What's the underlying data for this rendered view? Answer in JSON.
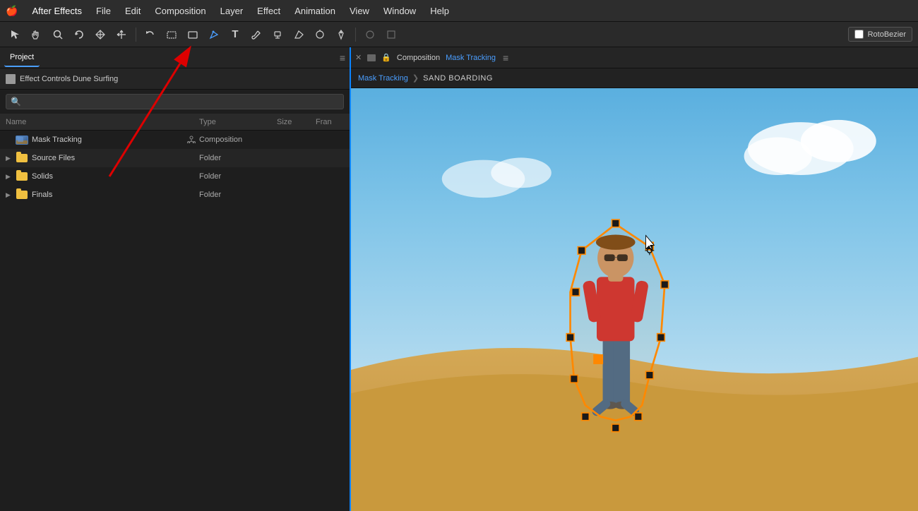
{
  "menubar": {
    "apple": "🍎",
    "items": [
      "After Effects",
      "File",
      "Edit",
      "Composition",
      "Layer",
      "Effect",
      "Animation",
      "View",
      "Window",
      "Help"
    ]
  },
  "toolbar": {
    "tools": [
      {
        "name": "selection-tool",
        "icon": "↖",
        "title": "Selection Tool"
      },
      {
        "name": "hand-tool",
        "icon": "✋",
        "title": "Hand Tool"
      },
      {
        "name": "zoom-tool",
        "icon": "🔍",
        "title": "Zoom Tool"
      },
      {
        "name": "rotate-tool",
        "icon": "↻",
        "title": "Rotate Tool"
      },
      {
        "name": "translate-tool",
        "icon": "✤",
        "title": "Translate Tool"
      },
      {
        "name": "move-tool",
        "icon": "↕",
        "title": "Move Tool"
      },
      {
        "name": "undo-tool",
        "icon": "↶",
        "title": "Undo"
      },
      {
        "name": "rect-tool",
        "icon": "⬜",
        "title": "Rectangle Tool"
      },
      {
        "name": "shape-tool",
        "icon": "⬛",
        "title": "Shape Tool"
      },
      {
        "name": "pen-tool",
        "icon": "✒",
        "title": "Pen Tool"
      },
      {
        "name": "text-tool",
        "icon": "T",
        "title": "Text Tool"
      },
      {
        "name": "brush-tool",
        "icon": "🖌",
        "title": "Brush Tool"
      },
      {
        "name": "stamp-tool",
        "icon": "⊕",
        "title": "Clone Stamp Tool"
      },
      {
        "name": "eraser-tool",
        "icon": "◇",
        "title": "Eraser Tool"
      },
      {
        "name": "roto-tool",
        "icon": "⊗",
        "title": "Roto Brush Tool"
      },
      {
        "name": "pin-tool",
        "icon": "📌",
        "title": "Pin Tool"
      }
    ],
    "roto_bezier_label": "RotoBezier"
  },
  "left_panel": {
    "project_tab": "Project",
    "effect_controls_tab": "Effect Controls Dune Surfing",
    "search_placeholder": "🔍",
    "columns": {
      "name": "Name",
      "type": "Type",
      "size": "Size",
      "fran": "Fran"
    },
    "items": [
      {
        "id": 1,
        "name": "Mask Tracking",
        "type": "Composition",
        "size": "",
        "fran": "",
        "icon": "comp",
        "expand": false,
        "selected": false
      },
      {
        "id": 2,
        "name": "Source Files",
        "type": "Folder",
        "size": "",
        "fran": "",
        "icon": "folder",
        "expand": false,
        "selected": true
      },
      {
        "id": 3,
        "name": "Solids",
        "type": "Folder",
        "size": "",
        "fran": "",
        "icon": "folder",
        "expand": false,
        "selected": false
      },
      {
        "id": 4,
        "name": "Finals",
        "type": "Folder",
        "size": "",
        "fran": "",
        "icon": "folder",
        "expand": false,
        "selected": false
      }
    ]
  },
  "right_panel": {
    "tab_label": "Composition",
    "tab_name_highlight": "Mask Tracking",
    "breadcrumb": {
      "first": "Mask Tracking",
      "separator": "❯",
      "second": "SAND BOARDING"
    },
    "comp_name": "Mask Tracking"
  },
  "colors": {
    "accent_blue": "#4a9eff",
    "folder_yellow": "#f0c040",
    "mask_orange": "#ff8c00",
    "panel_border": "#0a84ff",
    "panel_bg": "#1e1e1e",
    "menubar_bg": "#2d2d2d"
  }
}
